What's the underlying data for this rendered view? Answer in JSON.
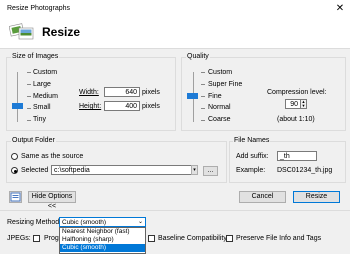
{
  "window": {
    "title": "Resize Photographs",
    "close_glyph": "✕"
  },
  "header": {
    "heading": "Resize",
    "icon": "photos-icon"
  },
  "size_group": {
    "label": "Size of Images",
    "levels": [
      "Custom",
      "Large",
      "Medium",
      "Small",
      "Tiny"
    ],
    "selected": "Small",
    "width_label": "Width:",
    "width_value": "640",
    "width_unit": "pixels",
    "height_label": "Height:",
    "height_value": "400",
    "height_unit": "pixels"
  },
  "quality_group": {
    "label": "Quality",
    "levels": [
      "Super Fine",
      "Fine",
      "Normal",
      "Coarse"
    ],
    "custom_label": "Custom",
    "selected": "Fine",
    "compression_label": "Compression level:",
    "compression_value": "90",
    "compression_note": "(about 1:10)"
  },
  "output_group": {
    "label": "Output Folder",
    "same_as_source": "Same as the source",
    "selected_label": "Selected",
    "path": "c:\\softpedia",
    "browse_label": "..."
  },
  "file_names_group": {
    "label": "File Names",
    "add_suffix_label": "Add suffix:",
    "suffix_value": "_th",
    "example_label": "Example:",
    "example_value": "DSC01234_th.jpg"
  },
  "buttons": {
    "hide_options": "Hide Options <<",
    "cancel": "Cancel",
    "resize": "Resize"
  },
  "options": {
    "resizing_method_label": "Resizing Method",
    "resizing_method_value": "Cubic (smooth)",
    "resizing_methods": [
      "Nearest Neighbor (fast)",
      "Halftoning (sharp)",
      "Cubic (smooth)"
    ],
    "jpegs_label": "JPEGs:",
    "progressive_label": "Prog",
    "baseline_label": "Baseline Compatibility",
    "preserve_label": "Preserve File Info and Tags"
  }
}
